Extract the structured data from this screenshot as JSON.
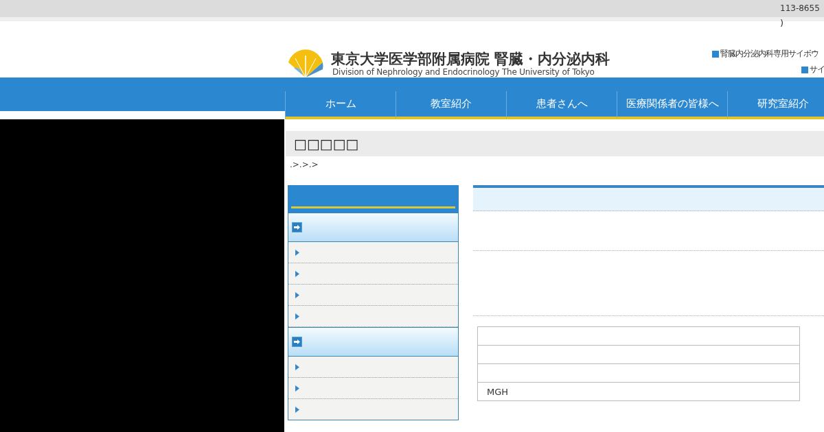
{
  "top_bar": {
    "postal_code": "113-8655",
    "bracket": ")"
  },
  "header": {
    "title": "東京大学医学部附属病院 腎臓・内分泌内科",
    "subtitle": "Division of Nephrology and Endocrinology The University of Tokyo",
    "links": [
      "腎臓内分泌内科専用サイボウ",
      "サイ"
    ]
  },
  "nav": [
    "ホーム",
    "教室紹介",
    "患者さんへ",
    "医療関係者の皆様へ",
    "研究室紹介"
  ],
  "page_title": "□□□□□",
  "breadcrumb": ".>.>.>",
  "table": {
    "cells": [
      "MGH"
    ]
  }
}
